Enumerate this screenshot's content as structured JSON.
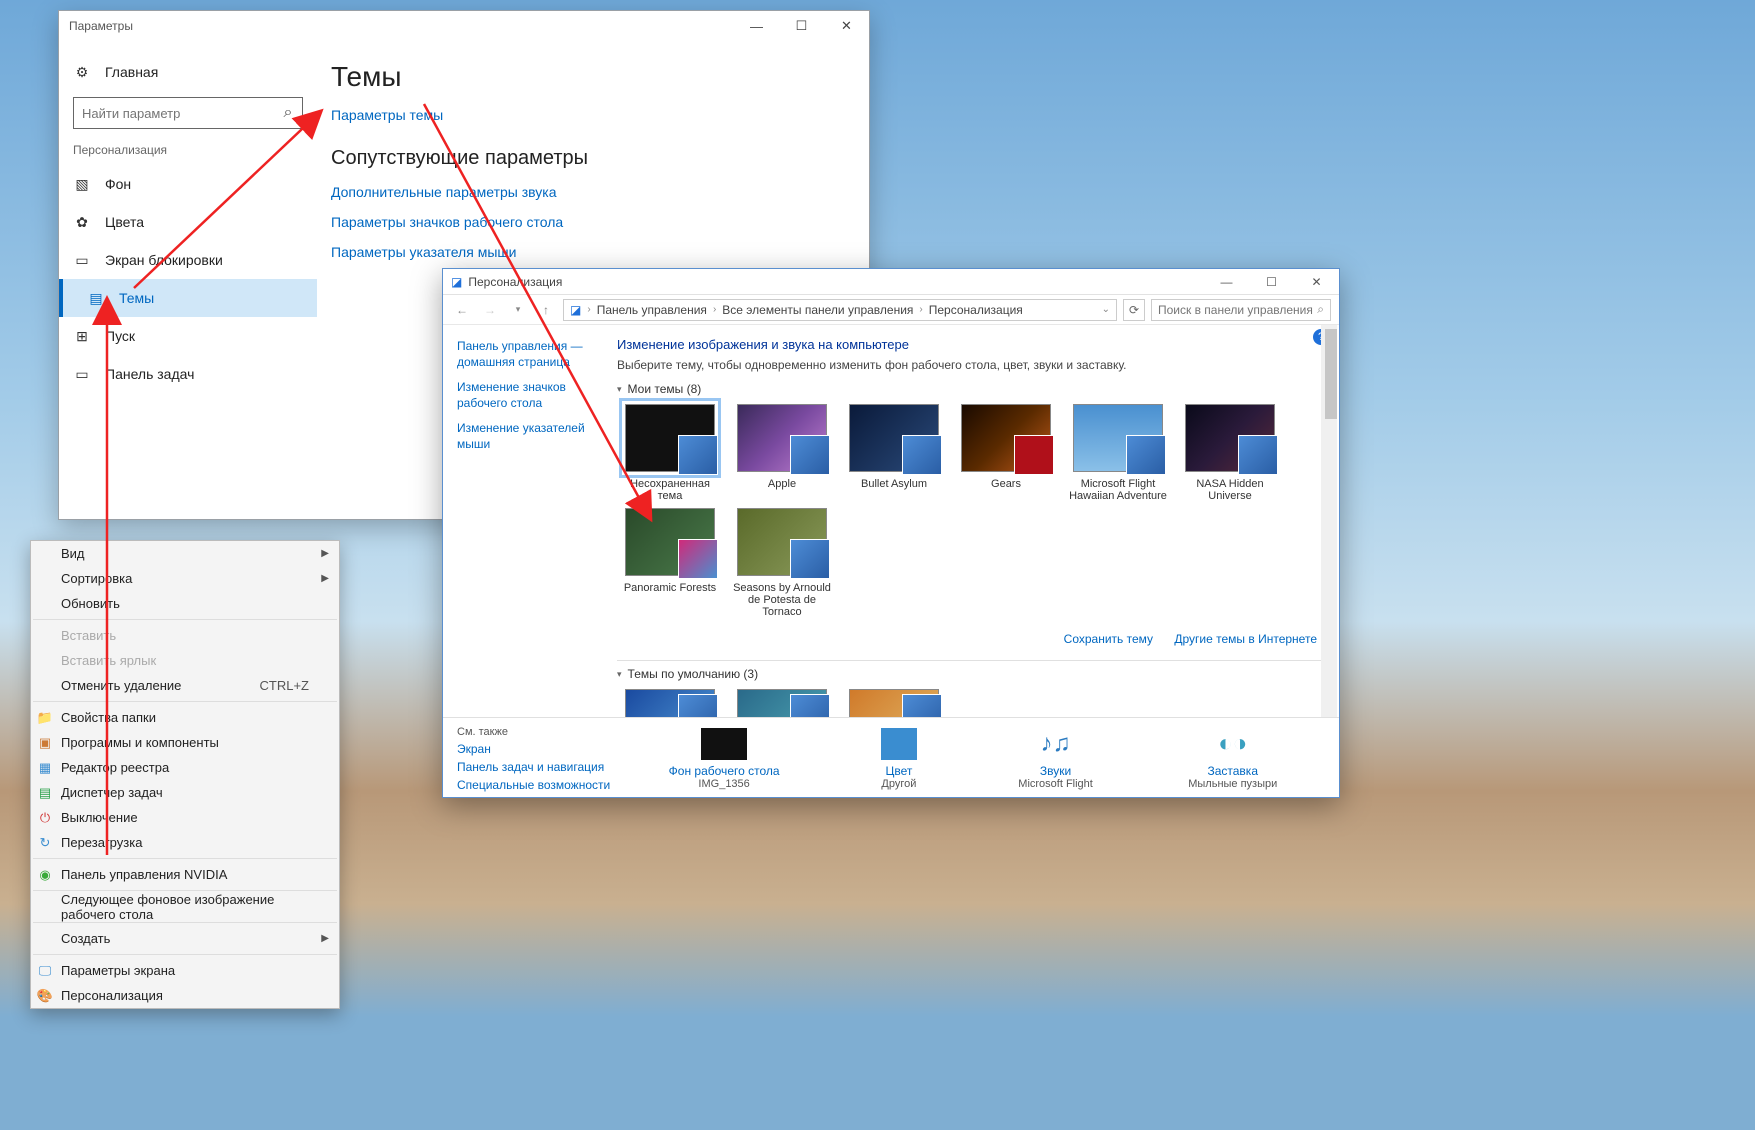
{
  "settings": {
    "title": "Параметры",
    "home": "Главная",
    "search_placeholder": "Найти параметр",
    "category": "Персонализация",
    "nav": {
      "background": "Фон",
      "colors": "Цвета",
      "lockscreen": "Экран блокировки",
      "themes": "Темы",
      "start": "Пуск",
      "taskbar": "Панель задач"
    },
    "page_title": "Темы",
    "link_theme_params": "Параметры темы",
    "h2_related": "Сопутствующие параметры",
    "link_sound": "Дополнительные параметры звука",
    "link_desktop_icons": "Параметры значков рабочего стола",
    "link_mouse": "Параметры указателя мыши"
  },
  "cp": {
    "title": "Персонализация",
    "bc1": "Панель управления",
    "bc2": "Все элементы панели управления",
    "bc3": "Персонализация",
    "search_placeholder": "Поиск в панели управления",
    "left": {
      "home": "Панель управления — домашняя страница",
      "icons": "Изменение значков рабочего стола",
      "pointers": "Изменение указателей мыши"
    },
    "heading": "Изменение изображения и звука на компьютере",
    "sub": "Выберите тему, чтобы одновременно изменить фон рабочего стола, цвет, звуки и заставку.",
    "group_my": "Мои темы (8)",
    "themes": {
      "t1": "Несохраненная тема",
      "t2": "Apple",
      "t3": "Bullet Asylum",
      "t4": "Gears",
      "t5": "Microsoft Flight Hawaiian Adventure",
      "t6": "NASA Hidden Universe",
      "t7": "Panoramic Forests",
      "t8": "Seasons by Arnould de Potesta de Tornaco"
    },
    "link_save": "Сохранить тему",
    "link_online": "Другие темы в Интернете",
    "group_default": "Темы по умолчанию (3)",
    "see_also": "См. также",
    "see_display": "Экран",
    "see_taskbar": "Панель задач и навигация",
    "see_access": "Специальные возможности",
    "bottom": {
      "bg": {
        "label": "Фон рабочего стола",
        "sub": "IMG_1356"
      },
      "color": {
        "label": "Цвет",
        "sub": "Другой"
      },
      "sounds": {
        "label": "Звуки",
        "sub": "Microsoft Flight"
      },
      "saver": {
        "label": "Заставка",
        "sub": "Мыльные пузыри"
      }
    }
  },
  "ctx": {
    "view": "Вид",
    "sort": "Сортировка",
    "refresh": "Обновить",
    "paste": "Вставить",
    "paste_shortcut": "Вставить ярлык",
    "undo_delete": "Отменить удаление",
    "undo_key": "CTRL+Z",
    "folder_props": "Свойства папки",
    "programs": "Программы и компоненты",
    "regedit": "Редактор реестра",
    "taskmgr": "Диспетчер задач",
    "shutdown": "Выключение",
    "restart": "Перезагрузка",
    "nvidia": "Панель управления NVIDIA",
    "next_wallpaper": "Следующее фоновое изображение рабочего стола",
    "create": "Создать",
    "display_settings": "Параметры экрана",
    "personalize": "Персонализация"
  }
}
